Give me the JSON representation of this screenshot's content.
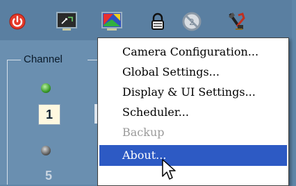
{
  "toolbar": {
    "icons": [
      "power-icon",
      "monitor-icon",
      "color-display-icon",
      "lock-icon",
      "no-sign-icon",
      "tools-icon"
    ]
  },
  "panel": {
    "group_label": "Channel",
    "channels": [
      {
        "number": "1",
        "status": "green"
      },
      {
        "number": "5",
        "status": "gray"
      }
    ]
  },
  "menu": {
    "items": [
      {
        "label": "Camera Configuration...",
        "state": "normal"
      },
      {
        "label": "Global Settings...",
        "state": "normal"
      },
      {
        "label": "Display & UI Settings...",
        "state": "normal"
      },
      {
        "label": "Scheduler...",
        "state": "normal"
      },
      {
        "label": "Backup",
        "state": "disabled"
      },
      {
        "label": "About...",
        "state": "selected"
      }
    ]
  },
  "colors": {
    "toolbar_bg": "#5a7fa1",
    "menu_highlight": "#2d5ac4",
    "disabled_text": "#9a9a9a"
  }
}
